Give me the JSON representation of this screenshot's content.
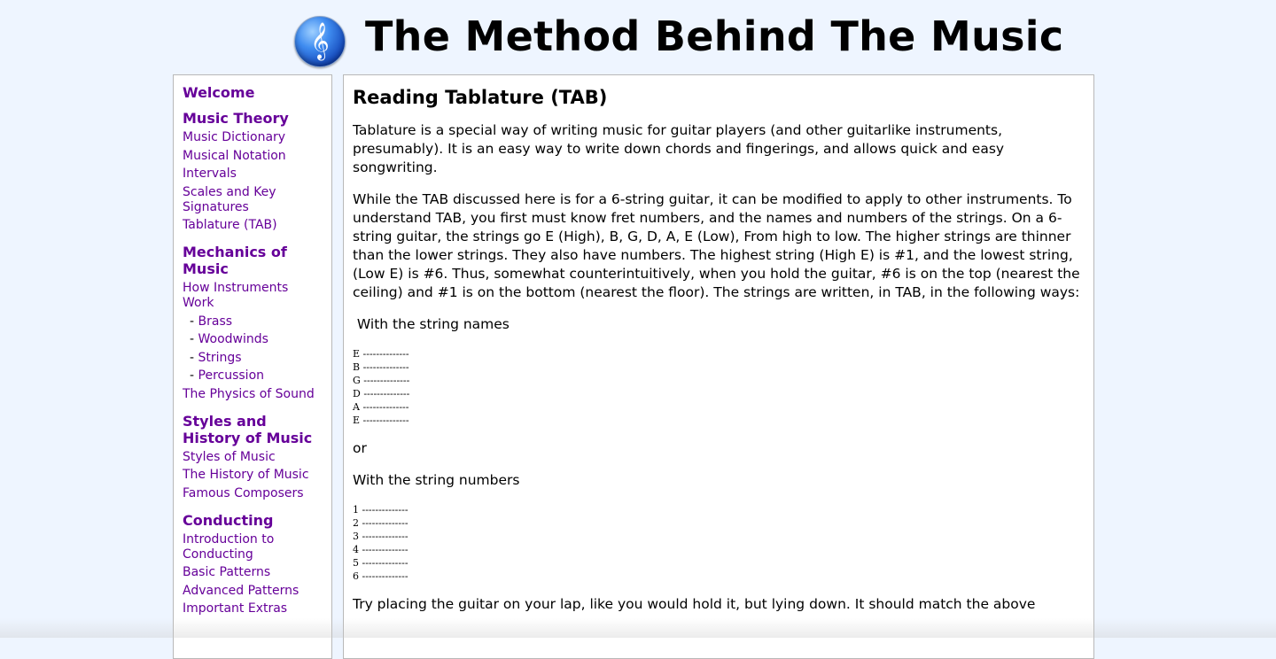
{
  "header": {
    "title": "The Method Behind The Music",
    "logo_icon": "treble-clef-icon",
    "logo_glyph": "𝄞"
  },
  "sidebar": {
    "welcome": "Welcome",
    "sections": [
      {
        "heading": "Music Theory",
        "links": [
          "Music Dictionary",
          "Musical Notation",
          "Intervals",
          "Scales and Key Signatures",
          "Tablature (TAB)"
        ]
      },
      {
        "heading": "Mechanics of Music",
        "links": [
          "How Instruments Work"
        ],
        "sublinks": [
          "Brass",
          "Woodwinds",
          "Strings",
          "Percussion"
        ],
        "links_after": [
          "The Physics of Sound"
        ]
      },
      {
        "heading": "Styles and History of Music",
        "links": [
          "Styles of Music",
          "The History of Music",
          "Famous Composers"
        ]
      },
      {
        "heading": "Conducting",
        "links": [
          "Introduction to Conducting",
          "Basic Patterns",
          "Advanced Patterns",
          "Important Extras"
        ]
      }
    ],
    "sub_dash": "- ",
    "link_color": "#660099"
  },
  "content": {
    "title": "Reading Tablature (TAB)",
    "para1": "Tablature is a special way of writing music for guitar players (and other guitarlike instruments, presumably). It is an easy way to write down chords and fingerings, and allows quick and easy songwriting.",
    "para2": "While the TAB discussed here is for a 6-string guitar, it can be modified to apply to other instruments. To understand TAB, you first must know fret numbers, and the names and numbers of the strings. On a 6-string guitar, the strings go E (High), B, G, D, A, E (Low), From high to low. The higher strings are thinner than the lower strings. They also have numbers. The highest string (High E) is #1, and the lowest string, (Low E) is #6. Thus, somewhat counterintuitively, when you hold the guitar, #6 is on the top (nearest the ceiling) and #1 is on the bottom (nearest the floor). The strings are written, in TAB, in the following ways:",
    "label_names": " With the string names",
    "tab_names": "E --------------\nB --------------\nG --------------\nD --------------\nA --------------\nE --------------",
    "or": "or",
    "label_numbers": "With the string numbers",
    "tab_numbers": "1 --------------\n2 --------------\n3 --------------\n4 --------------\n5 --------------\n6 --------------",
    "para3": "Try placing the guitar on your lap, like you would hold it, but lying down. It should match the above"
  }
}
